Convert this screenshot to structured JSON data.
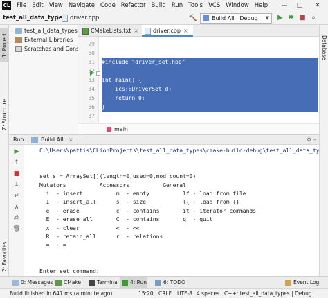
{
  "menubar": {
    "app_icon": "clion-logo-icon",
    "items": [
      {
        "pre": "",
        "u": "F",
        "post": "ile"
      },
      {
        "pre": "",
        "u": "E",
        "post": "dit"
      },
      {
        "pre": "",
        "u": "V",
        "post": "iew"
      },
      {
        "pre": "",
        "u": "N",
        "post": "avigate"
      },
      {
        "pre": "",
        "u": "C",
        "post": "ode"
      },
      {
        "pre": "",
        "u": "R",
        "post": "efactor"
      },
      {
        "pre": "",
        "u": "B",
        "post": "uild"
      },
      {
        "pre": "",
        "u": "R",
        "post": "un"
      },
      {
        "pre": "",
        "u": "T",
        "post": "ools"
      },
      {
        "pre": "VC",
        "u": "S",
        "post": ""
      },
      {
        "pre": "",
        "u": "W",
        "post": "indow"
      },
      {
        "pre": "",
        "u": "H",
        "post": "elp"
      }
    ],
    "window_controls": {
      "minimize": "—",
      "maximize": "□",
      "close": "✕"
    }
  },
  "navbar": {
    "project": "test_all_data_types",
    "separator": "〉",
    "file": "driver.cpp",
    "run_config": "Build All | Debug",
    "run_config_arrow": "▼",
    "toolbar_icons": [
      "hammer-icon",
      "run-icon",
      "debug-icon",
      "coverage-icon",
      "profile-icon",
      "stop-icon",
      "vcs-icon",
      "search-icon"
    ]
  },
  "tool_strip": {
    "project_tab": "1: Project",
    "structure_tab": "Z: Structure",
    "favorites_tab": "2: Favorites",
    "database_tab": "Database"
  },
  "project_tree": {
    "items": [
      {
        "arrow": "›",
        "icon": "folder-icon",
        "label": "test_all_data_types"
      },
      {
        "arrow": "›",
        "icon": "library-icon",
        "label": "External Libraries"
      },
      {
        "arrow": "",
        "icon": "scratches-icon",
        "label": "Scratches and Console"
      }
    ]
  },
  "editor_tabs": [
    {
      "label": "CMakeLists.txt",
      "close": "×"
    },
    {
      "label": "driver.cpp",
      "close": "×"
    }
  ],
  "editor": {
    "line_numbers": [
      "29",
      "30",
      "31",
      "32",
      "33",
      "34",
      "35",
      "36",
      "37"
    ],
    "lines": [
      "",
      "",
      "#include \"driver_set.hpp\"",
      "",
      "int main() {",
      "    ics::DriverSet d;",
      "    return 0;",
      "}",
      ""
    ],
    "selected_lines": [
      2,
      3,
      4,
      5,
      6,
      7
    ],
    "breadcrumb_fn": "main"
  },
  "run_panel": {
    "label": "Run:",
    "tab": "Build All",
    "tab_close": "×",
    "side_buttons": [
      "rerun-icon",
      "up-icon",
      "stop-icon",
      "down-icon",
      "wrap-icon",
      "pin-icon",
      "print-icon",
      "trash-icon"
    ],
    "console": [
      "C:\\Users\\pattis\\CLionProjects\\test_all_data_types\\cmake-build-debug\\test_all_data_types.exe",
      "",
      "",
      "set s = ArraySet[](length=0,used=0,mod_count=0)",
      "Mutators          Accessors          General",
      "  i  - insert          m  - empty          lf - load from file",
      "  I  - insert_all      s  - size           l{ - load from {}",
      "  e  - erase           c  - contains       it - iterator commands",
      "  E  - erase_all       C  - contains       q  - quit",
      "  x  - clear           <  - <<",
      "  R  - retain_all      r  - relations",
      "  =  - =",
      "",
      "",
      "Enter set command:"
    ]
  },
  "bottom_tabs": [
    {
      "label": "0: Messages",
      "icon": "messages-icon"
    },
    {
      "label": "CMake",
      "icon": "cmake-icon"
    },
    {
      "label": "Terminal",
      "icon": "terminal-icon"
    },
    {
      "label": "4: Run",
      "icon": "run-icon"
    },
    {
      "label": "6: TODO",
      "icon": "todo-icon"
    },
    {
      "label": "Event Log",
      "icon": "event-log-icon"
    }
  ],
  "status_bar": {
    "message": "Build finished in 647 ms (a minute ago)",
    "position": "15:20",
    "line_sep": "CRLF",
    "encoding": "UTF-8",
    "indent": "4 spaces",
    "context": "C++: test_all_data_types | Debug"
  },
  "colors": {
    "selection": "#466db5",
    "run_green": "#3c9b34",
    "accent": "#4a88c7"
  }
}
